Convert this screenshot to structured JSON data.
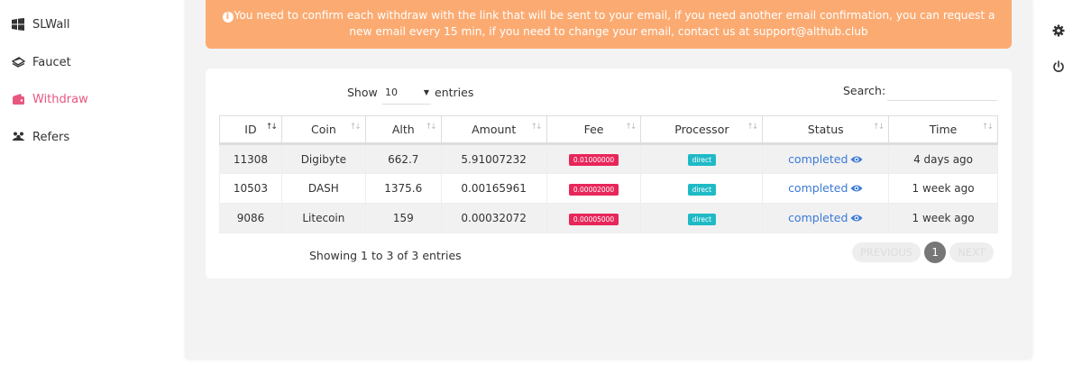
{
  "sidebar": {
    "items": [
      {
        "label": "SLWall",
        "icon": "windows-icon"
      },
      {
        "label": "Faucet",
        "icon": "faucet-icon"
      },
      {
        "label": "Withdraw",
        "icon": "wallet-icon"
      },
      {
        "label": "Refers",
        "icon": "users-icon"
      }
    ]
  },
  "alert": {
    "text": "You need to confirm each withdraw with the link that will be sent to your email, if you need another email confirmation, you can request a new email every 15 min, if you need to change your email, contact us at support@althub.club"
  },
  "table_controls": {
    "show_label": "Show",
    "entries_value": "10",
    "entries_label": "entries",
    "search_label": "Search:",
    "search_value": ""
  },
  "table": {
    "columns": [
      "ID",
      "Coin",
      "Alth",
      "Amount",
      "Fee",
      "Processor",
      "Status",
      "Time"
    ],
    "rows": [
      {
        "id": "11308",
        "coin": "Digibyte",
        "alth": "662.7",
        "amount": "5.91007232",
        "fee": "0.01000000",
        "processor": "direct",
        "status": "completed",
        "time": "4 days ago"
      },
      {
        "id": "10503",
        "coin": "DASH",
        "alth": "1375.6",
        "amount": "0.00165961",
        "fee": "0.00002000",
        "processor": "direct",
        "status": "completed",
        "time": "1 week ago"
      },
      {
        "id": "9086",
        "coin": "Litecoin",
        "alth": "159",
        "amount": "0.00032072",
        "fee": "0.00005000",
        "processor": "direct",
        "status": "completed",
        "time": "1 week ago"
      }
    ]
  },
  "footer": {
    "showing_text": "Showing 1 to 3 of 3 entries",
    "previous_label": "PREVIOUS",
    "page_number": "1",
    "next_label": "NEXT"
  },
  "colors": {
    "accent": "#e8577f",
    "alert_bg": "#fbab72",
    "fee_badge": "#e8265a",
    "processor_badge": "#1fbac6",
    "status_link": "#3b7ad6"
  },
  "right_icons": [
    "gear-icon",
    "power-icon"
  ]
}
